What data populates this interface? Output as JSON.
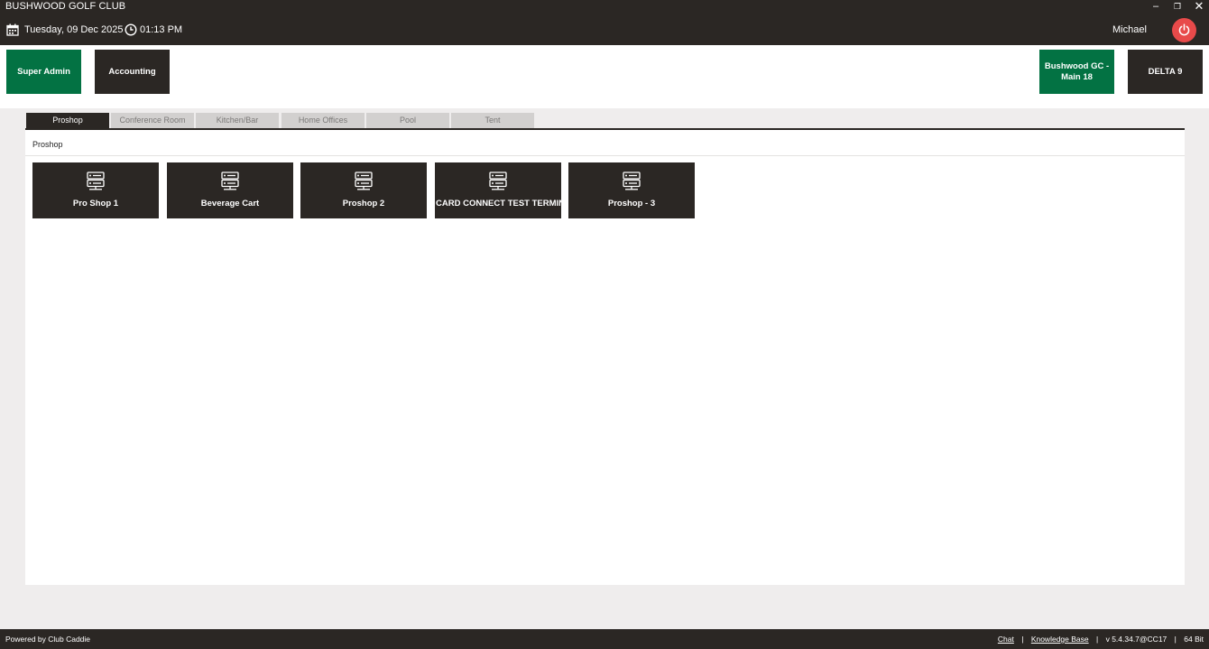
{
  "window": {
    "title": "BUSHWOOD GOLF CLUB",
    "minimize": "–",
    "restore": "❐",
    "close": "✕"
  },
  "header": {
    "date": "Tuesday,  09 Dec 2025",
    "time": "01:13 PM",
    "user": "Michael",
    "calendar_icon": "calendar-icon",
    "clock_icon": "clock-icon",
    "power_icon": "power-icon",
    "power_color": "#e84a4a"
  },
  "roles": {
    "super_admin": "Super Admin",
    "accounting": "Accounting",
    "location_line1": "Bushwood GC -",
    "location_line2": "Main 18",
    "delta": "DELTA 9"
  },
  "colors": {
    "accent_green": "#037243",
    "dark": "#2b2724"
  },
  "tabs": [
    {
      "label": "Proshop",
      "active": true
    },
    {
      "label": "Conference Room",
      "active": false
    },
    {
      "label": "Kitchen/Bar",
      "active": false
    },
    {
      "label": "Home Offices",
      "active": false
    },
    {
      "label": "Pool",
      "active": false
    },
    {
      "label": "Tent",
      "active": false
    }
  ],
  "panel": {
    "title": "Proshop"
  },
  "terminals": [
    {
      "label": "Pro Shop 1",
      "icon": "terminal-icon"
    },
    {
      "label": "Beverage Cart",
      "icon": "terminal-icon"
    },
    {
      "label": "Proshop 2",
      "icon": "terminal-icon"
    },
    {
      "label": "CARD CONNECT TEST TERMINAL",
      "icon": "terminal-icon"
    },
    {
      "label": "Proshop - 3",
      "icon": "terminal-icon"
    }
  ],
  "footer": {
    "powered_by": "Powered by Club Caddie",
    "chat": "Chat",
    "knowledge_base": "Knowledge Base",
    "version": "v 5.4.34.7@CC17",
    "bits": "64 Bit",
    "separator": "|"
  }
}
